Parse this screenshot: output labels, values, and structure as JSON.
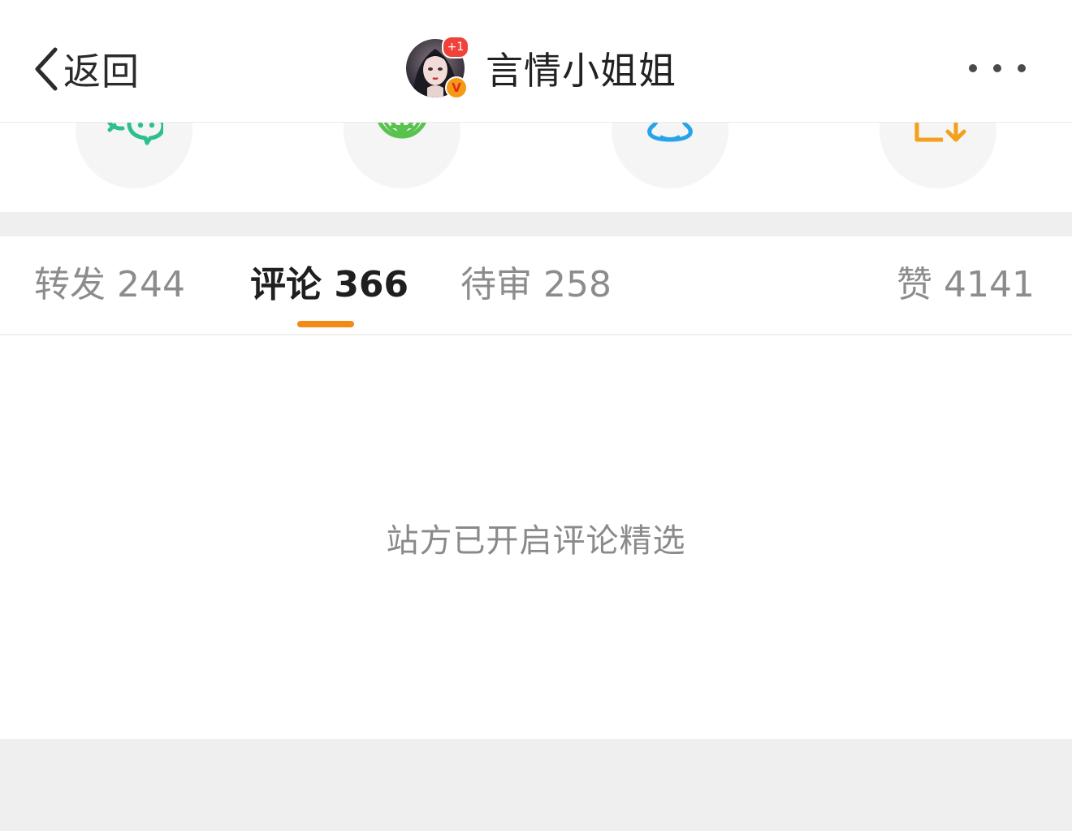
{
  "nav": {
    "back_label": "返回",
    "title": "言情小姐姐",
    "avatar_badge": "+1",
    "verified_badge": "V",
    "more_icon": "more-horizontal-icon"
  },
  "share": {
    "items": [
      {
        "icon": "wechat-icon",
        "color": "#2fbf8f"
      },
      {
        "icon": "moments-icon",
        "color": "#58c24f"
      },
      {
        "icon": "qq-icon",
        "color": "#27a3ea"
      },
      {
        "icon": "save-image-icon",
        "color": "#f3a11c"
      }
    ]
  },
  "tabs": {
    "repost": "转发 244",
    "comments": "评论 366",
    "pending": "待审 258",
    "likes": "赞 4141",
    "active": "comments",
    "accent_color": "#f28a18"
  },
  "content": {
    "notice": "站方已开启评论精选"
  }
}
